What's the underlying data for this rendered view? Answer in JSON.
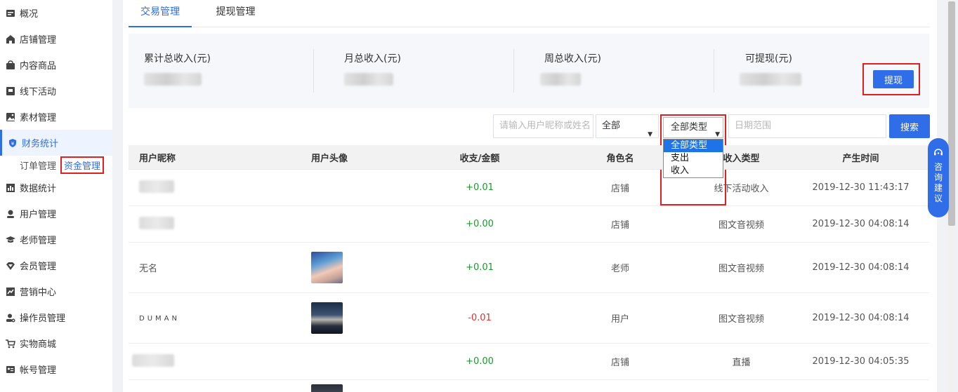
{
  "sidebar": {
    "items": [
      {
        "label": "概况",
        "icon": "overview-icon"
      },
      {
        "label": "店铺管理",
        "icon": "shop-icon"
      },
      {
        "label": "内容商品",
        "icon": "bag-icon"
      },
      {
        "label": "线下活动",
        "icon": "flag-icon"
      },
      {
        "label": "素材管理",
        "icon": "image-icon"
      },
      {
        "label": "财务统计",
        "icon": "shield-icon",
        "active": true
      },
      {
        "label": "数据统计",
        "icon": "bar-chart-icon"
      },
      {
        "label": "用户管理",
        "icon": "user-icon"
      },
      {
        "label": "老师管理",
        "icon": "graduation-cap-icon"
      },
      {
        "label": "会员管理",
        "icon": "diamond-icon"
      },
      {
        "label": "营销中心",
        "icon": "trend-icon"
      },
      {
        "label": "操作员管理",
        "icon": "user-settings-icon"
      },
      {
        "label": "实物商城",
        "icon": "cart-icon"
      },
      {
        "label": "帐号管理",
        "icon": "id-card-icon"
      }
    ],
    "subitems": [
      "订单管理",
      "资金管理"
    ]
  },
  "tabs": [
    "交易管理",
    "提现管理"
  ],
  "stats": [
    {
      "label": "累计总收入(元)"
    },
    {
      "label": "月总收入(元)"
    },
    {
      "label": "周总收入(元)"
    },
    {
      "label": "可提现(元)"
    }
  ],
  "withdraw_label": "提现",
  "filters": {
    "name_placeholder": "请输入用户昵称或姓名",
    "role_value": "全部",
    "type_value": "全部类型",
    "type_options": [
      "全部类型",
      "支出",
      "收入"
    ],
    "date_placeholder": "日期范围",
    "search_label": "搜索"
  },
  "table": {
    "headers": [
      "用户昵称",
      "用户头像",
      "收支/金额",
      "角色名",
      "收入类型",
      "产生时间"
    ],
    "rows": [
      {
        "nickname": "",
        "amount": "+0.01",
        "role": "店铺",
        "type": "线下活动收入",
        "time": "2019-12-30 11:43:17"
      },
      {
        "nickname": "",
        "amount": "+0.00",
        "role": "店铺",
        "type": "图文音视频",
        "time": "2019-12-30 04:08:14"
      },
      {
        "nickname": "无名",
        "amount": "+0.01",
        "role": "老师",
        "type": "图文音视频",
        "time": "2019-12-30 04:08:14"
      },
      {
        "nickname": "DUMAN",
        "amount": "-0.01",
        "role": "用户",
        "type": "图文音视频",
        "time": "2019-12-30 04:08:14"
      },
      {
        "nickname": "",
        "amount": "+0.00",
        "role": "店铺",
        "type": "直播",
        "time": "2019-12-30 04:05:35"
      }
    ]
  },
  "consult": {
    "chars": [
      "咨",
      "询",
      "建",
      "议"
    ]
  },
  "colors": {
    "accent": "#2f6ee8",
    "highlight": "#e02020",
    "positive": "#1a9a2c",
    "negative": "#e03030"
  }
}
